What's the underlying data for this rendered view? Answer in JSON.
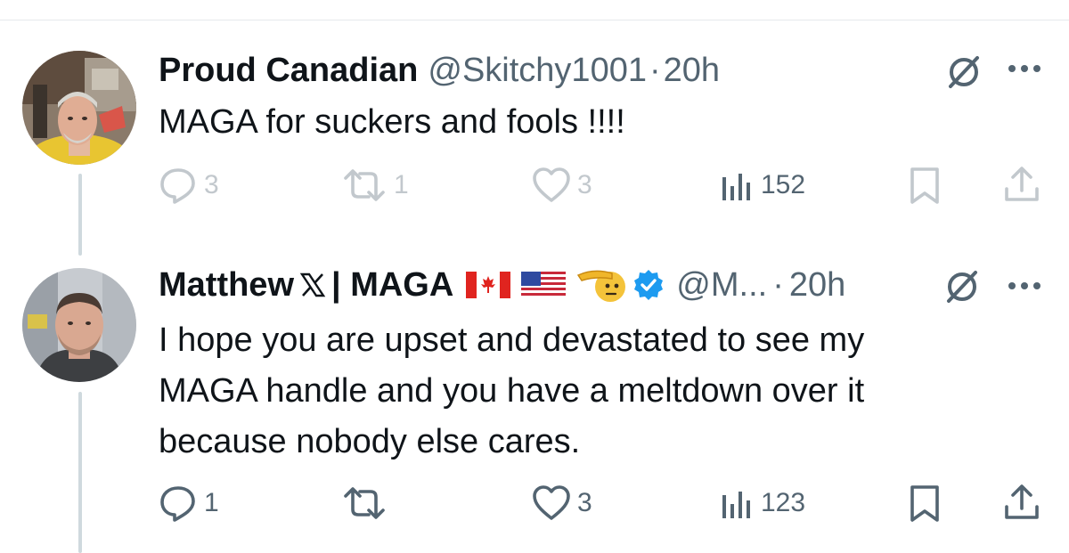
{
  "tweets": [
    {
      "display_name": "Proud Canadian",
      "handle": "@Skitchy1001",
      "separator": "·",
      "time": "20h",
      "text": "MAGA for suckers and fools !!!!",
      "actions": {
        "replies": "3",
        "reposts": "1",
        "likes": "3",
        "views": "152"
      }
    },
    {
      "display_name": "Matthew",
      "name_suffix": "| MAGA",
      "handle": "@M...",
      "separator": "·",
      "time": "20h",
      "verified": true,
      "text_lines": [
        "I hope you are upset and devastated to see my",
        "MAGA handle and you have a meltdown over it",
        "because nobody else cares."
      ],
      "actions": {
        "replies": "1",
        "reposts": "",
        "likes": "3",
        "views": "123"
      }
    }
  ],
  "colors": {
    "text": "#0f1419",
    "secondary": "#536471",
    "verified": "#1d9bf0",
    "thread_line": "#cfd9de"
  },
  "icons": {
    "reply": "speech-bubble-icon",
    "repost": "repost-arrows-icon",
    "like": "heart-icon",
    "views": "bar-chart-icon",
    "bookmark": "bookmark-icon",
    "share": "share-upload-icon",
    "grok": "grok-slash-circle-icon",
    "more": "more-dots-icon"
  }
}
